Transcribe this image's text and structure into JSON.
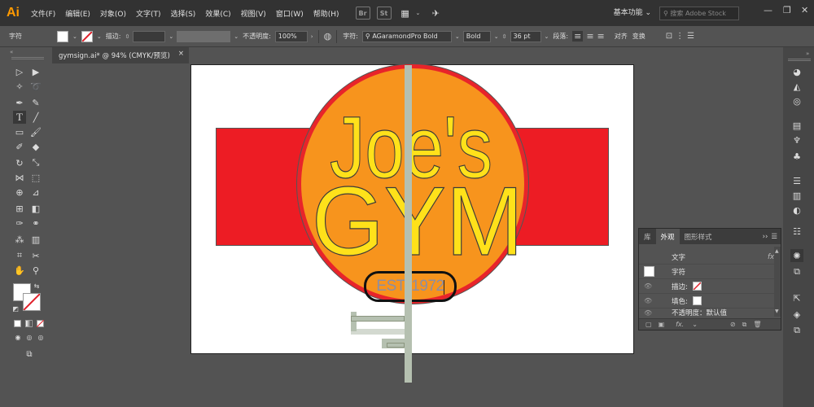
{
  "app": {
    "logo": "Ai"
  },
  "menu": [
    "文件(F)",
    "编辑(E)",
    "对象(O)",
    "文字(T)",
    "选择(S)",
    "效果(C)",
    "视图(V)",
    "窗口(W)",
    "帮助(H)"
  ],
  "menubar_icons": {
    "bridge": "Br",
    "stock": "St"
  },
  "workspace": "基本功能",
  "search": {
    "placeholder": "搜索 Adobe Stock"
  },
  "control": {
    "type_label": "字符",
    "stroke_label": "描边:",
    "opacity_label": "不透明度:",
    "opacity_value": "100%",
    "char_label": "字符:",
    "font_family": "AGaramondPro Bold",
    "font_style": "Bold",
    "font_size": "36 pt",
    "para_label": "段落:",
    "align_label": "对齐",
    "transform_label": "变换"
  },
  "document": {
    "tab_title": "gymsign.ai* @ 94% (CMYK/预览)"
  },
  "artwork": {
    "line1": "Joe's",
    "line2": "GYM",
    "est": "EST. 1972"
  },
  "appearance_panel": {
    "tabs": [
      "库",
      "外观",
      "图形样式"
    ],
    "active_tab": "外观",
    "header": "文字",
    "rows": [
      {
        "label": "字符"
      },
      {
        "label": "描边:"
      },
      {
        "label": "填色:"
      },
      {
        "label": "不透明度：默认值"
      }
    ],
    "fx": "fx."
  },
  "colors": {
    "banner": "#ed1c24",
    "circle_ring": "#e8242a",
    "circle_fill": "#f7941d",
    "text_fill": "#ffe11a",
    "est_text": "#8b8ea5",
    "guide": "#b5c0b0"
  }
}
